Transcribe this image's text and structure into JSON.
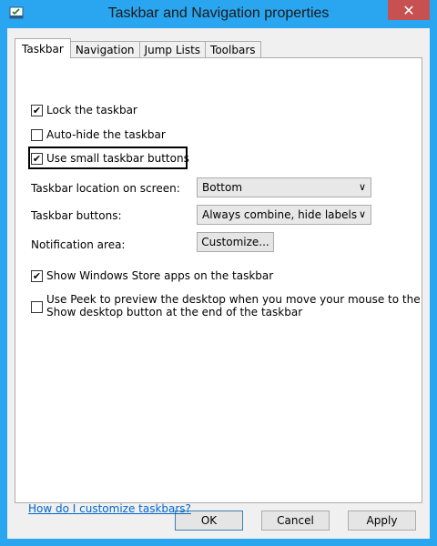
{
  "window": {
    "title": "Taskbar and Navigation properties",
    "close_glyph": "✕",
    "icon": "taskbar-properties-icon",
    "accent_color": "#2aa5ef",
    "close_color": "#c75050"
  },
  "tabs": [
    {
      "label": "Taskbar",
      "active": true
    },
    {
      "label": "Navigation",
      "active": false
    },
    {
      "label": "Jump Lists",
      "active": false
    },
    {
      "label": "Toolbars",
      "active": false
    }
  ],
  "taskbar": {
    "lock": {
      "label": "Lock the taskbar",
      "checked": true
    },
    "autohide": {
      "label": "Auto-hide the taskbar",
      "checked": false
    },
    "small_buttons": {
      "label": "Use small taskbar buttons",
      "checked": true
    },
    "location": {
      "label": "Taskbar location on screen:",
      "value": "Bottom"
    },
    "buttons": {
      "label": "Taskbar buttons:",
      "value": "Always combine, hide labels"
    },
    "notification": {
      "label": "Notification area:",
      "button": "Customize..."
    },
    "store_apps": {
      "label": "Show Windows Store apps on the taskbar",
      "checked": true
    },
    "peek": {
      "line1": "Use Peek to preview the desktop when you move your mouse to the",
      "line2": "Show desktop button at the end of the taskbar",
      "checked": false
    },
    "help_link": "How do I customize taskbars?"
  },
  "footer": {
    "ok": "OK",
    "cancel": "Cancel",
    "apply": "Apply"
  },
  "glyphs": {
    "check": "✔",
    "chevron": "∨"
  }
}
